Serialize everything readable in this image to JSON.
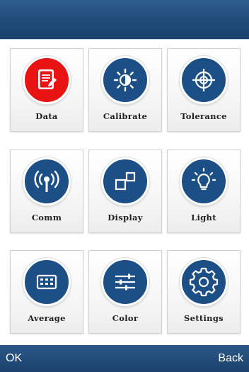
{
  "header": {
    "title": ""
  },
  "colors": {
    "accent": "#1b4f86",
    "active": "#e81414",
    "bar": "#1f4a78"
  },
  "menu": {
    "items": [
      {
        "label": "Data",
        "icon": "document-icon",
        "active": true
      },
      {
        "label": "Calibrate",
        "icon": "brightness-icon",
        "active": false
      },
      {
        "label": "Tolerance",
        "icon": "crosshair-icon",
        "active": false
      },
      {
        "label": "Comm",
        "icon": "wireless-icon",
        "active": false
      },
      {
        "label": "Display",
        "icon": "squares-icon",
        "active": false
      },
      {
        "label": "Light",
        "icon": "lightbulb-icon",
        "active": false
      },
      {
        "label": "Average",
        "icon": "keyboard-icon",
        "active": false
      },
      {
        "label": "Color",
        "icon": "sliders-icon",
        "active": false
      },
      {
        "label": "Settings",
        "icon": "gear-icon",
        "active": false
      }
    ]
  },
  "softkeys": {
    "ok": "OK",
    "back": "Back"
  }
}
